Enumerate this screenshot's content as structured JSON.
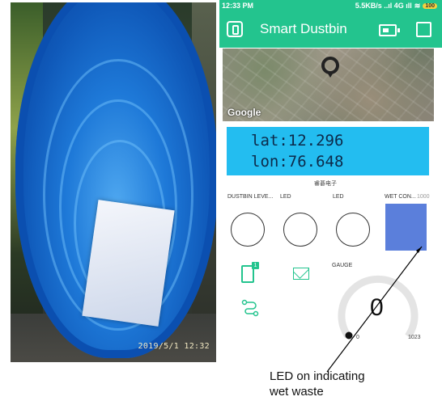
{
  "photo": {
    "timestamp": "2019/5/1  12:32"
  },
  "status_bar": {
    "time": "12:33 PM",
    "network": "5.5KB/s ..ıl 4G ıll",
    "wifi_icon": "wifi-icon",
    "battery": "100"
  },
  "app_bar": {
    "title": "Smart Dustbin",
    "icons": [
      "back-icon",
      "device-icon",
      "square-icon"
    ]
  },
  "map": {
    "attribution": "Google"
  },
  "lcd": {
    "line1": "lat:12.296",
    "line2": "lon:76.648",
    "caption": "睿碁电子"
  },
  "widgets": {
    "dustbin_level_label": "DUSTBIN LEVE...",
    "led1_label": "LED",
    "led2_label": "LED",
    "wet_label": "WET CON...",
    "wet_value": "1000",
    "gauge_label": "GAUGE",
    "gauge_value": "0",
    "gauge_min": "0",
    "gauge_max": "1023"
  },
  "annotation": {
    "line1": "LED on indicating",
    "line2": "wet waste"
  },
  "colors": {
    "brand": "#23c48e",
    "lcd": "#23bdf0",
    "wet_led": "#5b7fdb"
  }
}
